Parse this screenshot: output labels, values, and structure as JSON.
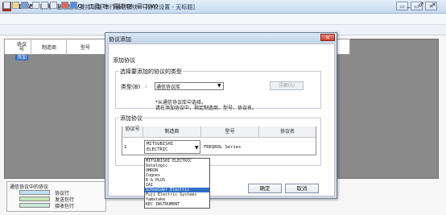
{
  "window": {
    "title": "MELSOFT系列 - 通信协议支持功能-串行通信模块- - [协议设置 - 无标题]",
    "controls": [
      "▭",
      "▭",
      "✕"
    ]
  },
  "menubar": {
    "items": [
      "文件(F)",
      "编辑(E)",
      "在线(O)",
      "工具(T)",
      "调试(D)",
      "窗口(W)"
    ],
    "mdi_controls": "_ ♂ ✕"
  },
  "grid": {
    "headers": [
      "协议号",
      "制造商",
      "型号"
    ],
    "selected_row": "添加"
  },
  "legend": {
    "title": "通信协议中的协议",
    "items": [
      {
        "label": "协议行",
        "color": "#bfe0f5"
      },
      {
        "label": "发送包行",
        "color": "#c6e6b7"
      },
      {
        "label": "接收包行",
        "color": "#c8e8d9"
      }
    ]
  },
  "dialog": {
    "title": "协议添加",
    "close": "✕",
    "section_add": "添加协议",
    "group_type_title": "选择要添加的协议的类型",
    "type_label": "类型(B)",
    "type_colon": ":",
    "type_value": "通信协议库",
    "detail_button": "详细(S)",
    "hint_line1": "*从通信协议库中选择。",
    "hint_line2": "请在添加协议中，指定制造商、型号、协议名。",
    "group_add_title": "添加协议",
    "table": {
      "headers": [
        "协议号",
        "制造商",
        "型号",
        "协议名"
      ],
      "row": {
        "number": "1",
        "maker_line1": "MITSUBISHI",
        "maker_line2": "ELECTRIC",
        "model": "FREQROL Series",
        "protocol_name": ""
      }
    },
    "dropdown_options": [
      "MITSUBISHI ELECTRIC",
      "Datalogic",
      "OMRON",
      "Cognex",
      "B & PLUS",
      "IAI",
      "Schneider Electric",
      "Fuji Electric Systems",
      "Yamatake",
      "KEC INSTRUMENT"
    ],
    "dropdown_selected": "Schneider Electric",
    "ok_button": "确定",
    "cancel_button": "取消"
  },
  "colors": {
    "accent": "#2f6fc4",
    "title_bar": "#c8daef",
    "workspace_gray": "#8a8a8a"
  }
}
